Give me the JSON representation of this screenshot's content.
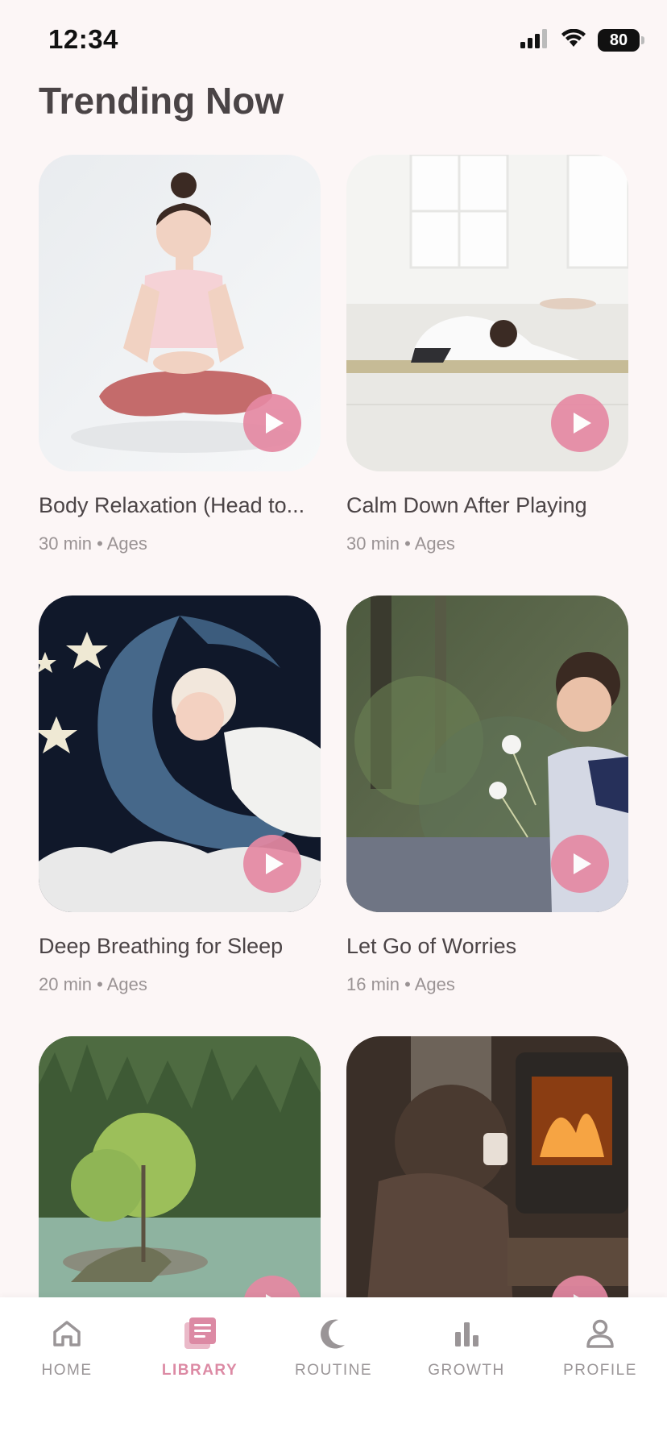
{
  "status_bar": {
    "time": "12:34",
    "battery": "80"
  },
  "page": {
    "title": "Trending Now"
  },
  "cards": [
    {
      "title": "Body Relaxation (Head to...",
      "meta": "30 min • Ages"
    },
    {
      "title": "Calm Down After Playing",
      "meta": "30 min • Ages"
    },
    {
      "title": "Deep Breathing for Sleep",
      "meta": "20 min • Ages"
    },
    {
      "title": "Let Go of Worries",
      "meta": "16 min • Ages"
    }
  ],
  "nav": {
    "home": "HOME",
    "library": "LIBRARY",
    "routine": "ROUTINE",
    "growth": "GROWTH",
    "profile": "PROFILE",
    "active": "library",
    "active_color": "#dc8aa4",
    "inactive_color": "#9a9597"
  },
  "colors": {
    "background": "#fcf6f6",
    "play_button": "#e589a3"
  },
  "icons": [
    "signal-icon",
    "wifi-icon",
    "battery-icon",
    "play-icon",
    "home-icon",
    "library-icon",
    "moon-icon",
    "bar-chart-icon",
    "user-icon"
  ]
}
